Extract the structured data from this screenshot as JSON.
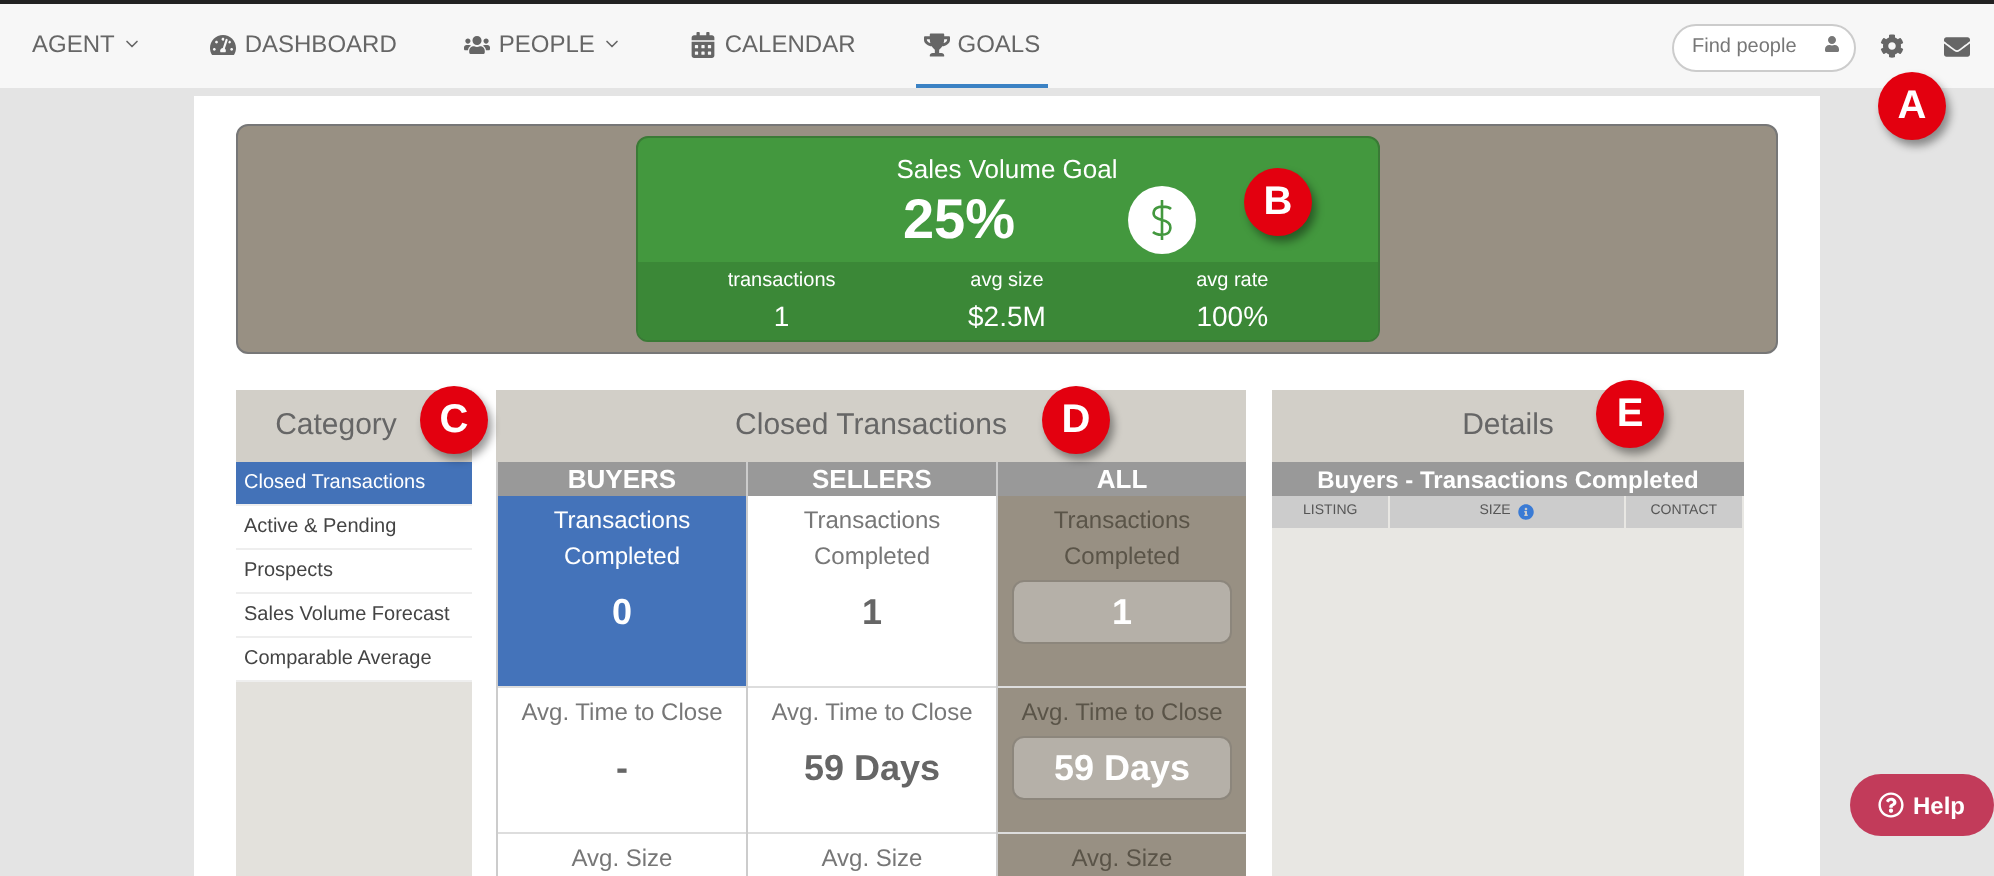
{
  "nav": {
    "items": [
      {
        "label": "AGENT",
        "dropdown": true,
        "selected": false
      },
      {
        "label": "DASHBOARD",
        "dropdown": false,
        "selected": false
      },
      {
        "label": "PEOPLE",
        "dropdown": true,
        "selected": false
      },
      {
        "label": "CALENDAR",
        "dropdown": false,
        "selected": false
      },
      {
        "label": "GOALS",
        "dropdown": false,
        "selected": true
      }
    ],
    "search": {
      "placeholder": "Find people"
    }
  },
  "goal_card": {
    "title": "Sales Volume Goal",
    "percent": "25%",
    "stats": [
      {
        "label": "transactions",
        "value": "1"
      },
      {
        "label": "avg size",
        "value": "$2.5M"
      },
      {
        "label": "avg rate",
        "value": "100%"
      }
    ]
  },
  "category": {
    "title": "Category",
    "items": [
      {
        "label": "Closed Transactions",
        "selected": true
      },
      {
        "label": "Active & Pending",
        "selected": false
      },
      {
        "label": "Prospects",
        "selected": false
      },
      {
        "label": "Sales Volume Forecast",
        "selected": false
      },
      {
        "label": "Comparable Average",
        "selected": false
      }
    ]
  },
  "closed": {
    "title": "Closed Transactions",
    "columns": [
      {
        "heading": "BUYERS",
        "kind": "standard",
        "selected": true,
        "cells": [
          {
            "label": "Transactions Completed",
            "value": "0"
          },
          {
            "label": "Avg. Time to Close",
            "value": "-"
          },
          {
            "label": "Avg. Size"
          }
        ]
      },
      {
        "heading": "SELLERS",
        "kind": "standard",
        "selected": false,
        "cells": [
          {
            "label": "Transactions Completed",
            "value": "1"
          },
          {
            "label": "Avg. Time to Close",
            "value": "59 Days"
          },
          {
            "label": "Avg. Size"
          }
        ]
      },
      {
        "heading": "ALL",
        "kind": "total",
        "selected": false,
        "cells": [
          {
            "label": "Transactions Completed",
            "value": "1"
          },
          {
            "label": "Avg. Time to Close",
            "value": "59 Days"
          },
          {
            "label": "Avg. Size"
          }
        ]
      }
    ]
  },
  "details": {
    "title": "Details",
    "subtitle": "Buyers - Transactions Completed",
    "columns": [
      {
        "label": "LISTING",
        "info": false
      },
      {
        "label": "SIZE",
        "info": true
      },
      {
        "label": "CONTACT",
        "info": false
      }
    ]
  },
  "help_button": {
    "label": "Help"
  },
  "callouts": [
    "A",
    "B",
    "C",
    "D",
    "E"
  ]
}
